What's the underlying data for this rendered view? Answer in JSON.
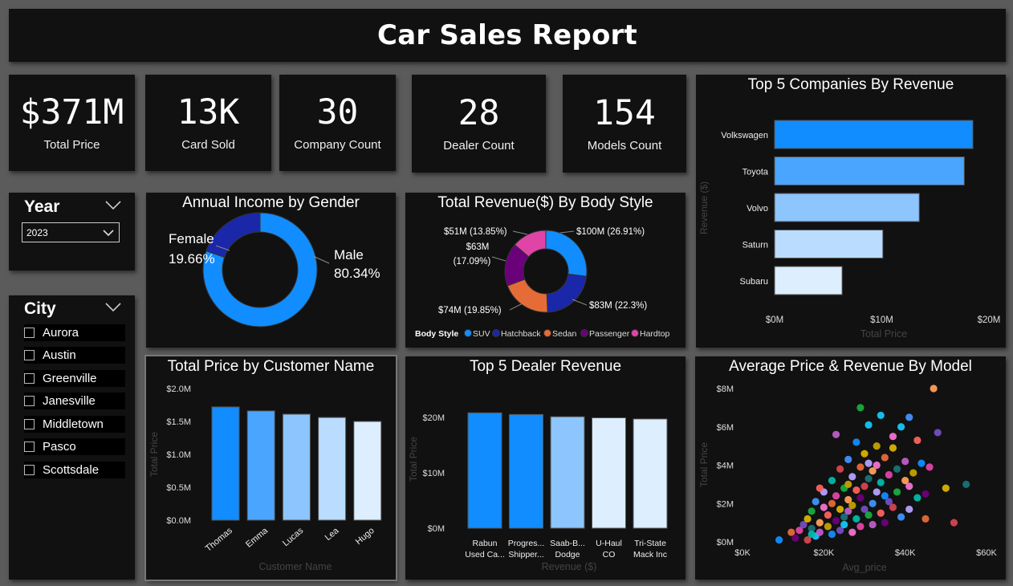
{
  "header": {
    "title": "Car Sales Report"
  },
  "kpis": [
    {
      "value": "$371M",
      "label": "Total Price"
    },
    {
      "value": "13K",
      "label": "Card Sold"
    },
    {
      "value": "30",
      "label": "Company Count"
    },
    {
      "value": "28",
      "label": "Dealer Count"
    },
    {
      "value": "154",
      "label": "Models Count"
    }
  ],
  "slicers": {
    "year": {
      "title": "Year",
      "selected": "2023"
    },
    "city": {
      "title": "City",
      "items": [
        "Aurora",
        "Austin",
        "Greenville",
        "Janesville",
        "Middletown",
        "Pasco",
        "Scottsdale"
      ]
    }
  },
  "colors": {
    "c1": "#118DFF",
    "c2": "#4aa5ff",
    "c3": "#8dc5ff",
    "c4": "#b9dcff",
    "c5": "#ddeeff",
    "dark_blue": "#1a27a8",
    "orange": "#e66c37",
    "purple": "#6b007b",
    "pink": "#e044a7"
  },
  "chart_data": [
    {
      "id": "gender",
      "type": "pie",
      "title": "Annual Income by Gender",
      "slices": [
        {
          "label": "Male",
          "pct_label": "80.34%",
          "value": 80.34,
          "color": "#118DFF"
        },
        {
          "label": "Female",
          "pct_label": "19.66%",
          "value": 19.66,
          "color": "#1a27a8"
        }
      ]
    },
    {
      "id": "body",
      "type": "pie",
      "title": "Total Revenue($) By Body Style",
      "legend_title": "Body Style",
      "slices": [
        {
          "name": "SUV",
          "value": 100,
          "label": "$100M (26.91%)",
          "color": "#118DFF"
        },
        {
          "name": "Hatchback",
          "value": 83,
          "label": "$83M (22.3%)",
          "color": "#1a27a8"
        },
        {
          "name": "Sedan",
          "value": 74,
          "label": "$74M (19.85%)",
          "color": "#e66c37"
        },
        {
          "name": "Passenger",
          "value": 63,
          "label_lines": [
            "$63M",
            "(17.09%)"
          ],
          "color": "#6b007b"
        },
        {
          "name": "Hardtop",
          "value": 51,
          "label": "$51M (13.85%)",
          "color": "#e044a7"
        }
      ]
    },
    {
      "id": "companies",
      "type": "bar",
      "orientation": "horizontal",
      "title": "Top 5 Companies By Revenue",
      "xlabel": "Total Price",
      "ylabel": "Revenue ($)",
      "categories": [
        "Volkswagen",
        "Toyota",
        "Volvo",
        "Saturn",
        "Subaru"
      ],
      "values": [
        18.5,
        17.7,
        13.5,
        10.1,
        6.3
      ],
      "xlim": [
        0,
        20
      ],
      "xticks": [
        "$0M",
        "$10M",
        "$20M"
      ]
    },
    {
      "id": "customers",
      "type": "bar",
      "title": "Total Price by Customer Name",
      "xlabel": "Customer Name",
      "ylabel": "Total Price",
      "categories": [
        "Thomas",
        "Emma",
        "Lucas",
        "Lea",
        "Hugo"
      ],
      "values": [
        1.72,
        1.66,
        1.61,
        1.56,
        1.5
      ],
      "ylim": [
        0,
        2
      ],
      "yticks": [
        "$0.0M",
        "$0.5M",
        "$1.0M",
        "$1.5M",
        "$2.0M"
      ]
    },
    {
      "id": "dealers",
      "type": "bar",
      "title": "Top 5 Dealer Revenue",
      "xlabel": "Revenue ($)",
      "ylabel": "Total Price",
      "categories": [
        [
          "Rabun",
          "Used Ca..."
        ],
        [
          "Progres...",
          "Shipper..."
        ],
        [
          "Saab-B...",
          "Dodge"
        ],
        [
          "U-Haul",
          "CO"
        ],
        [
          "Tri-State",
          "Mack Inc"
        ]
      ],
      "values": [
        20.8,
        20.5,
        20.1,
        19.9,
        19.7
      ],
      "ylim": [
        0,
        22
      ],
      "yticks": [
        {
          "v": 0,
          "t": "$0M"
        },
        {
          "v": 10,
          "t": "$10M"
        },
        {
          "v": 20,
          "t": "$20M"
        }
      ]
    },
    {
      "id": "models",
      "type": "scatter",
      "title": "Average Price & Revenue By Model",
      "xlabel": "Avg_price",
      "ylabel": "Total Price",
      "xlim": [
        0,
        60
      ],
      "ylim": [
        0,
        8
      ],
      "xticks": [
        "$0K",
        "$20K",
        "$40K",
        "$60K"
      ],
      "yticks": [
        "$0M",
        "$2M",
        "$4M",
        "$6M",
        "$8M"
      ],
      "points": [
        [
          9,
          0.1
        ],
        [
          12,
          0.5
        ],
        [
          13,
          0.2
        ],
        [
          14,
          0.6
        ],
        [
          15,
          0.9
        ],
        [
          16,
          1.2
        ],
        [
          16,
          0.1
        ],
        [
          17,
          0.7
        ],
        [
          17,
          1.6
        ],
        [
          18,
          0.3
        ],
        [
          18,
          2.1
        ],
        [
          19,
          1.0
        ],
        [
          19,
          0.5
        ],
        [
          20,
          1.8
        ],
        [
          20,
          2.6
        ],
        [
          21,
          0.8
        ],
        [
          21,
          1.4
        ],
        [
          22,
          3.2
        ],
        [
          22,
          0.4
        ],
        [
          22,
          2.0
        ],
        [
          23,
          1.1
        ],
        [
          23,
          2.4
        ],
        [
          24,
          0.6
        ],
        [
          24,
          1.7
        ],
        [
          24,
          3.8
        ],
        [
          25,
          1.3
        ],
        [
          25,
          2.8
        ],
        [
          25,
          0.9
        ],
        [
          26,
          4.3
        ],
        [
          26,
          2.2
        ],
        [
          26,
          1.6
        ],
        [
          27,
          0.5
        ],
        [
          27,
          3.4
        ],
        [
          27,
          1.9
        ],
        [
          28,
          2.7
        ],
        [
          28,
          1.2
        ],
        [
          28,
          5.2
        ],
        [
          29,
          3.9
        ],
        [
          29,
          2.3
        ],
        [
          29,
          0.8
        ],
        [
          30,
          1.7
        ],
        [
          30,
          4.6
        ],
        [
          30,
          2.9
        ],
        [
          31,
          3.3
        ],
        [
          31,
          1.4
        ],
        [
          31,
          6.1
        ],
        [
          32,
          2.0
        ],
        [
          32,
          3.7
        ],
        [
          32,
          0.9
        ],
        [
          33,
          4.0
        ],
        [
          33,
          2.6
        ],
        [
          33,
          5.0
        ],
        [
          34,
          1.5
        ],
        [
          34,
          3.1
        ],
        [
          35,
          2.4
        ],
        [
          35,
          4.4
        ],
        [
          35,
          1.0
        ],
        [
          36,
          3.5
        ],
        [
          36,
          2.1
        ],
        [
          37,
          4.9
        ],
        [
          37,
          1.8
        ],
        [
          38,
          3.8
        ],
        [
          38,
          2.6
        ],
        [
          39,
          6.0
        ],
        [
          39,
          1.3
        ],
        [
          40,
          3.2
        ],
        [
          40,
          4.2
        ],
        [
          41,
          2.9
        ],
        [
          41,
          1.7
        ],
        [
          42,
          3.6
        ],
        [
          43,
          5.3
        ],
        [
          43,
          2.3
        ],
        [
          44,
          4.1
        ],
        [
          45,
          1.2
        ],
        [
          45,
          2.5
        ],
        [
          46,
          3.9
        ],
        [
          48,
          5.7
        ],
        [
          50,
          2.8
        ],
        [
          52,
          1.0
        ],
        [
          55,
          3.0
        ],
        [
          29,
          7.0
        ],
        [
          34,
          6.6
        ],
        [
          41,
          6.5
        ],
        [
          47,
          8.0
        ],
        [
          23,
          5.6
        ],
        [
          37,
          5.5
        ],
        [
          31,
          4.1
        ],
        [
          26,
          3.0
        ],
        [
          19,
          2.8
        ],
        [
          17,
          0.4
        ]
      ]
    }
  ]
}
